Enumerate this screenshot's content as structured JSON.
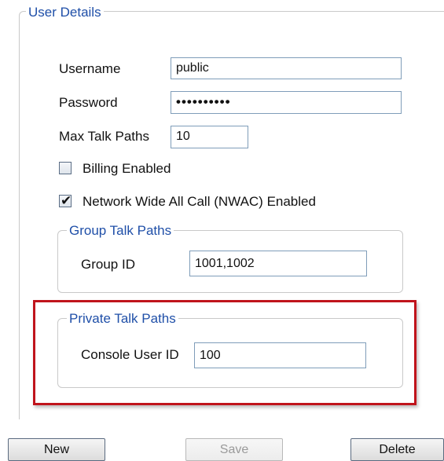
{
  "user_details": {
    "title": "User Details",
    "username_label": "Username",
    "username_value": "public",
    "password_label": "Password",
    "password_value": "••••••••••",
    "max_talk_paths_label": "Max Talk Paths",
    "max_talk_paths_value": "10",
    "billing_enabled_label": "Billing Enabled",
    "billing_enabled_checked": false,
    "nwac_label": "Network Wide All Call (NWAC) Enabled",
    "nwac_checked": true
  },
  "group_talk_paths": {
    "title": "Group Talk Paths",
    "group_id_label": "Group ID",
    "group_id_value": "1001,1002"
  },
  "private_talk_paths": {
    "title": "Private Talk Paths",
    "console_user_id_label": "Console User ID",
    "console_user_id_value": "100"
  },
  "buttons": {
    "new_label": "New",
    "save_label": "Save",
    "delete_label": "Delete"
  },
  "colors": {
    "legend": "#1f4fa8",
    "highlight": "#c0141c"
  }
}
